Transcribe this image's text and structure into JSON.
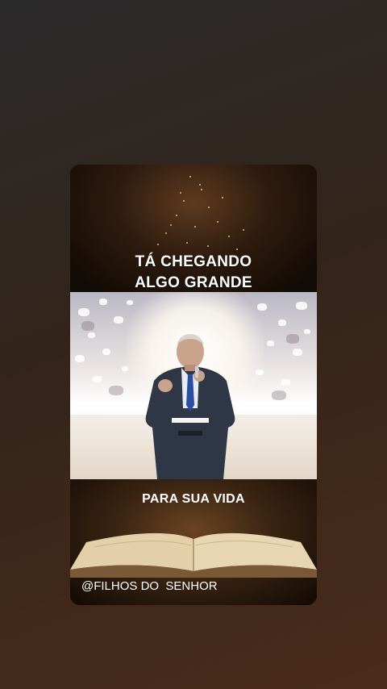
{
  "story": {
    "headline_line1": "TÁ CHEGANDO",
    "headline_line2": "ALGO GRANDE",
    "subline": "PARA SUA VIDA",
    "handle": "@FILHOS DO  SENHOR"
  },
  "colors": {
    "background": "#33241a",
    "card_dark": "#140c06",
    "text": "#ffffff",
    "suit": "#2f3645",
    "tie": "#2b4f9e"
  }
}
